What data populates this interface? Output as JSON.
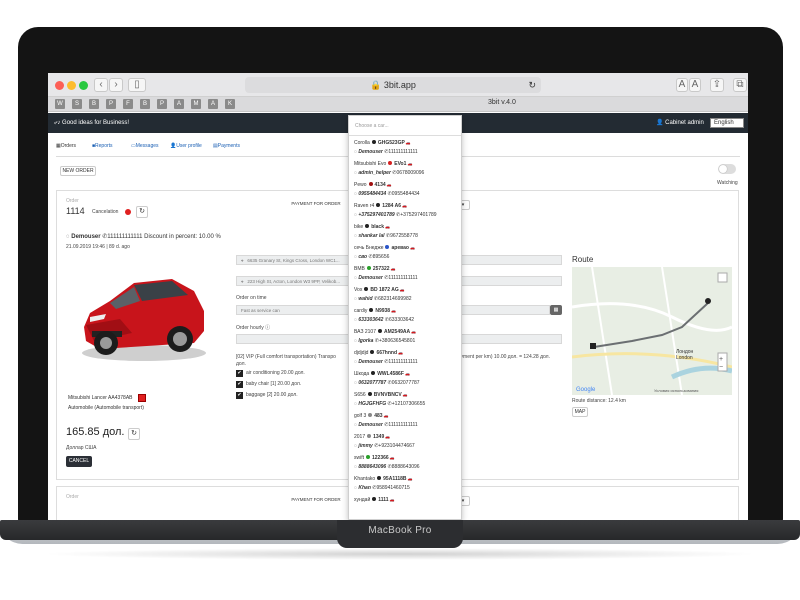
{
  "browser": {
    "url": "3bit.app",
    "tab_title": "3bit v.4.0",
    "favicons": [
      "W",
      "S",
      "B",
      "P",
      "F",
      "B",
      "P",
      "A",
      "M",
      "A",
      "K"
    ],
    "reader_labels": [
      "A",
      "A"
    ]
  },
  "device": {
    "label": "MacBook Pro"
  },
  "header": {
    "slogan": "Good ideas for Business!",
    "user": "Cabinet admin",
    "language": "English"
  },
  "nav": {
    "tabs": [
      "Orders",
      "Reports",
      "Messages",
      "User profile",
      "Payments"
    ]
  },
  "toolbar": {
    "new_order": "NEW ORDER",
    "watching": "Watching"
  },
  "order": {
    "label": "Order",
    "number": "1114",
    "status": "Cancelation",
    "customer": "Demouser",
    "phone": "111111111111",
    "discount": "Discount in percent: 10.00 %",
    "datetime": "21.09.2019 19:46",
    "age": "89 d. ago",
    "from": "6635 Granary St, Kings Cross, London WC1...",
    "to": "223 High St, Acton, London W3 9PP, Velikob...",
    "order_on_time_label": "Order on time",
    "fast_as_service": "Fast as service can",
    "order_hourly_label": "Order hourly",
    "tariff": "[02] VIP (Full comfort transportation) Transpo",
    "tariff_tail": "payment per km) 10.00 дол. = 124.28 дол.",
    "extras": [
      "air conditioning 20.00 дол.",
      "baby chair [1] 20.00 дол.",
      "baggage [2] 20.00 дол."
    ],
    "car_name": "Mitsubishi Lancer AA4378AB",
    "car_type": "Automobile (Automobile transport)",
    "price": "165.85 дол.",
    "currency": "Доллар США",
    "cancel": "CANCEL",
    "payment_btn": "PAYMENT FOR ORDER",
    "route_title": "Route",
    "route_distance": "Route distance: 12.4 km",
    "map_btn": "MAP",
    "map_city": "Лондон\nLondon",
    "map_footer": "Условия использования"
  },
  "order2": {
    "label": "Order",
    "payment_btn": "PAYMENT FOR ORDER"
  },
  "car_dropdown": {
    "placeholder": "Choose a car...",
    "options": [
      {
        "model": "Corolla",
        "color": "#222222",
        "plate": "GHG523GP",
        "driver": "Demouser",
        "phone": "111111111111"
      },
      {
        "model": "Mitsubishi Evo",
        "color": "#d62020",
        "plate": "EVo1",
        "driver": "admin_helper",
        "phone": "0678009096"
      },
      {
        "model": "Pewo",
        "color": "#a01010",
        "plate": "4134",
        "driver": "0955484434",
        "phone": "0955484434"
      },
      {
        "model": "Raven r4",
        "color": "#222222",
        "plate": "1284 A6",
        "driver": "+375297401789",
        "phone": "+375297401789"
      },
      {
        "model": "bike",
        "color": "#222222",
        "plate": "black",
        "driver": "shankar lal",
        "phone": "9672558778"
      },
      {
        "model": "сечь Бнедже",
        "color": "#2a55c8",
        "plate": "аревао",
        "driver": "сво",
        "phone": "895656"
      },
      {
        "model": "BMB",
        "color": "#2aa02a",
        "plate": "257322",
        "driver": "Demouser",
        "phone": "111111111111"
      },
      {
        "model": "Vox",
        "color": "#222222",
        "plate": "BD 1872 AG",
        "driver": "wahid",
        "phone": "682314699982"
      },
      {
        "model": "cardiy",
        "color": "#222222",
        "plate": "N9938",
        "driver": "633303642",
        "phone": "633303642"
      },
      {
        "model": "ВАЗ 2107",
        "color": "#222222",
        "plate": "AM2549AA",
        "driver": "Igorka",
        "phone": "+380636545801"
      },
      {
        "model": "djdjdjd",
        "color": "#222222",
        "plate": "667hnnd",
        "driver": "Demouser",
        "phone": "111111111111"
      },
      {
        "model": "Шкода",
        "color": "#222222",
        "plate": "WWL4586F",
        "driver": "0632077787",
        "phone": "0632077787"
      },
      {
        "model": "S656",
        "color": "#222222",
        "plate": "BVNVBNCV",
        "driver": "HGJGFHFG",
        "phone": "+12107306655"
      },
      {
        "model": "golf 3",
        "color": "#888888",
        "plate": "483",
        "driver": "Demouser",
        "phone": "111111111111"
      },
      {
        "model": "2017",
        "color": "#888888",
        "plate": "1349",
        "driver": "jimmy",
        "phone": "+923104474667"
      },
      {
        "model": "swift",
        "color": "#2aa02a",
        "plate": "122366",
        "driver": "8888643096",
        "phone": "8888643096"
      },
      {
        "model": "Khantako",
        "color": "#222222",
        "plate": "95A1118B",
        "driver": "Khan",
        "phone": "958941460715"
      },
      {
        "model": "хундай",
        "color": "#222222",
        "plate": "1111",
        "driver": "",
        "phone": ""
      }
    ]
  },
  "colors": {
    "header_bg": "#232b33",
    "link": "#1a5fb4",
    "status_red": "#e02020",
    "price_btn": "#2b2f36"
  }
}
